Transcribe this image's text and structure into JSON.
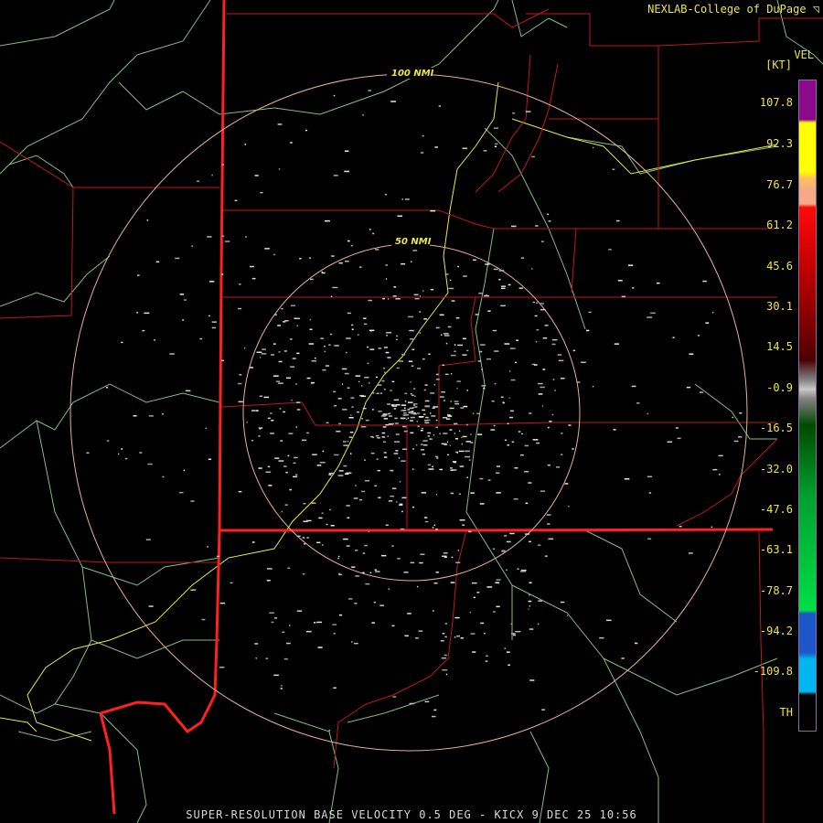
{
  "credit": "NEXLAB-College of DuPage",
  "legend": {
    "title": "VEL",
    "unit": "[KT]",
    "ticks": [
      "107.8",
      "92.3",
      "76.7",
      "61.2",
      "45.6",
      "30.1",
      "14.5",
      "-0.9",
      "-16.5",
      "-32.0",
      "-47.6",
      "-63.1",
      "-78.7",
      "-94.2",
      "-109.8",
      "TH"
    ],
    "colors": {
      "purple": "#8b0a8b",
      "yellow": "#ffff00",
      "peach": "#f6a888",
      "red": "#ff0a0a",
      "darkred": "#4a0000",
      "gray": "#c8c8c8",
      "darkgreen": "#004a00",
      "green": "#00dd44",
      "blue": "#1c56c8",
      "cyan": "#00b6f0",
      "black": "#000000"
    }
  },
  "rings": [
    {
      "label": "100 NMI"
    },
    {
      "label": "50 NMI"
    }
  ],
  "footer": "SUPER-RESOLUTION BASE VELOCITY 0.5 DEG - KICX 9 DEC 25 10:56"
}
